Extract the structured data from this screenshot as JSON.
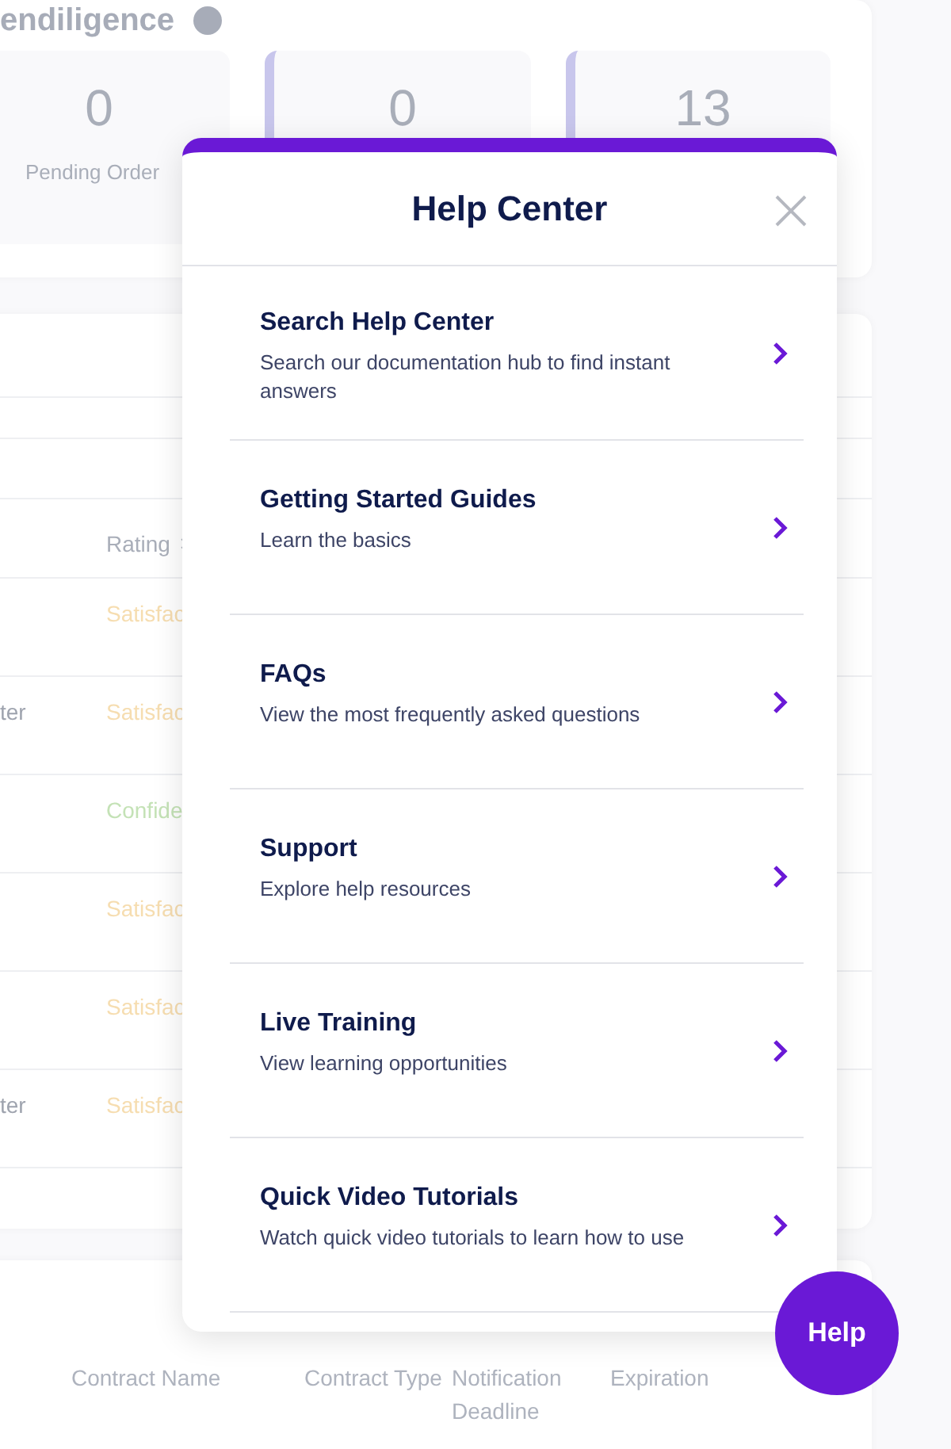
{
  "page_heading": "endiligence",
  "stats": [
    {
      "value": "0",
      "label": "Pending Order",
      "accent": false
    },
    {
      "value": "0",
      "accent": true
    },
    {
      "value": "13",
      "accent": true
    }
  ],
  "ratings_table": {
    "header": "Rating",
    "rows": [
      {
        "column_1": "",
        "rating": "Satisfac",
        "color": "#f6ddb0"
      },
      {
        "column_1": "ter",
        "rating": "Satisfac",
        "color": "#f6ddb0"
      },
      {
        "column_1": "",
        "rating": "Confide",
        "color": "#c4e2b6"
      },
      {
        "column_1": "",
        "rating": "Satisfac",
        "color": "#f6ddb0"
      },
      {
        "column_1": "",
        "rating": "Satisfac",
        "color": "#f6ddb0"
      },
      {
        "column_1": "ter",
        "rating": "Satisfac",
        "color": "#f6ddb0"
      }
    ]
  },
  "contracts_table": {
    "columns": [
      "Contract Name",
      "Contract Type",
      "Notification Deadline",
      "Expiration"
    ]
  },
  "help_center": {
    "title": "Help Center",
    "items": [
      {
        "title": "Search Help Center",
        "description": "Search our documentation hub to find instant answers"
      },
      {
        "title": "Getting Started Guides",
        "description": "Learn the basics"
      },
      {
        "title": "FAQs",
        "description": "View the most frequently asked questions"
      },
      {
        "title": "Support",
        "description": "Explore help resources"
      },
      {
        "title": "Live Training",
        "description": "View learning opportunities"
      },
      {
        "title": "Quick Video Tutorials",
        "description": "Watch quick video tutorials to learn how to use"
      }
    ]
  },
  "help_button": "Help"
}
